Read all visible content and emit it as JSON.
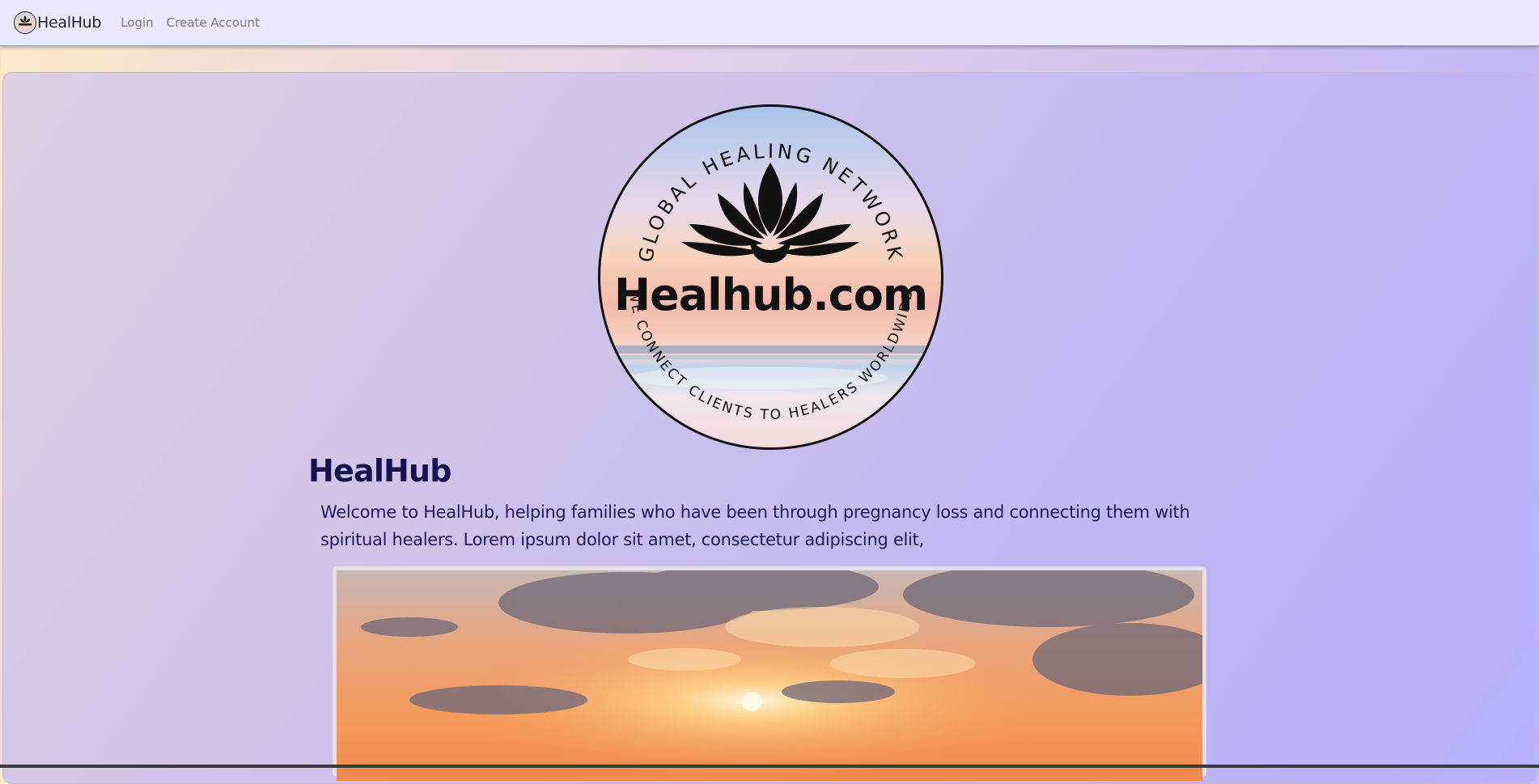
{
  "nav": {
    "brand": "HealHub",
    "links": [
      "Login",
      "Create Account"
    ]
  },
  "logo": {
    "top_arc_text": "GLOBAL HEALING NETWORK",
    "center_text": "Healhub.com",
    "bottom_arc_text": "WE CONNECT CLIENTS TO HEALERS WORLDWIDE"
  },
  "main": {
    "title": "HealHub",
    "intro_line1": "Welcome to HealHub, helping families who have been through pregnancy loss and connecting them with",
    "intro_line2": "spiritual healers. Lorem ipsum dolor sit amet, consectetur adipiscing elit,"
  },
  "colors": {
    "navbar_bg": "#eae9ff",
    "title": "#15134f",
    "text": "#1d1b5c"
  },
  "icons": [
    "lotus-icon"
  ]
}
